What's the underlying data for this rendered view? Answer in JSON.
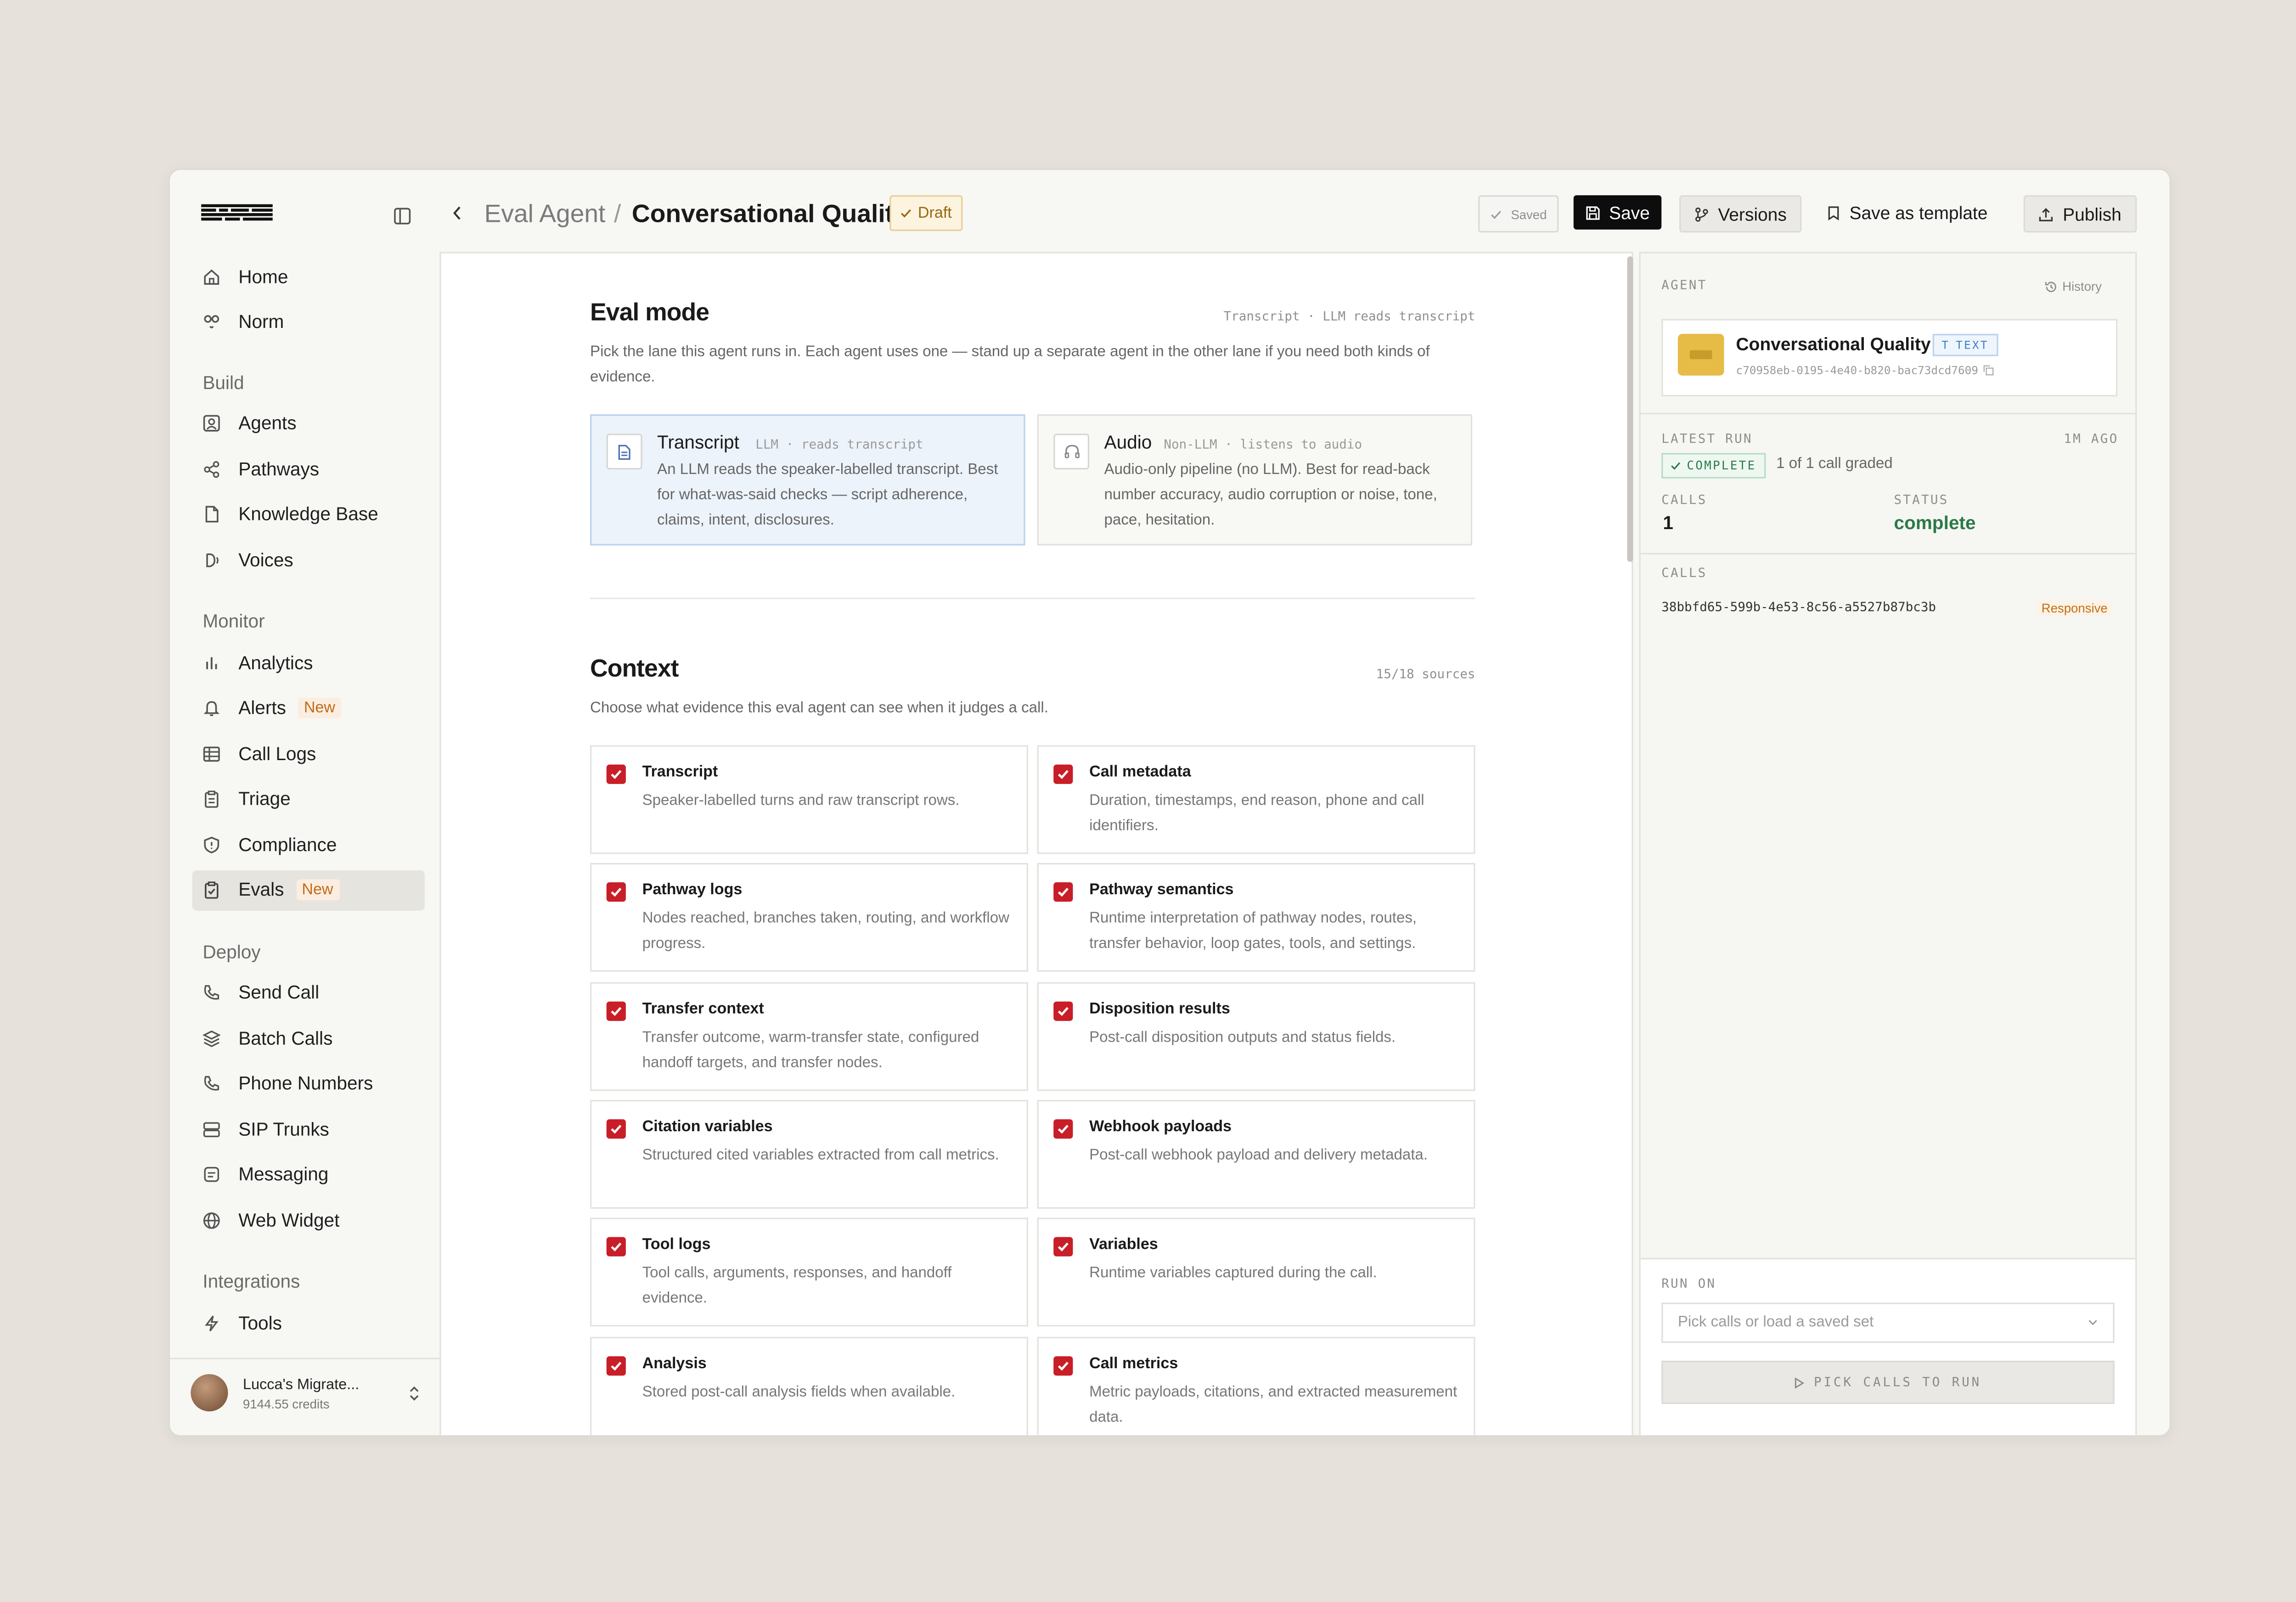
{
  "app": {
    "logo": "logo-icon",
    "colors": {
      "accent_red": "#c81e28",
      "draft_bg": "#fcf4df",
      "selected_blue": "#edf3fb",
      "success_green": "#2b7a47"
    }
  },
  "sidebar": {
    "items_top": [
      {
        "label": "Home",
        "icon": "home-icon"
      },
      {
        "label": "Norm",
        "icon": "norm-icon"
      }
    ],
    "sections": [
      {
        "title": "Build",
        "items": [
          {
            "label": "Agents",
            "icon": "agent-icon"
          },
          {
            "label": "Pathways",
            "icon": "share-nodes-icon"
          },
          {
            "label": "Knowledge Base",
            "icon": "document-icon"
          },
          {
            "label": "Voices",
            "icon": "voice-icon"
          }
        ]
      },
      {
        "title": "Monitor",
        "items": [
          {
            "label": "Analytics",
            "icon": "bar-chart-icon"
          },
          {
            "label": "Alerts",
            "icon": "bell-icon",
            "badge": "New"
          },
          {
            "label": "Call Logs",
            "icon": "table-icon"
          },
          {
            "label": "Triage",
            "icon": "clipboard-icon"
          },
          {
            "label": "Compliance",
            "icon": "shield-icon"
          },
          {
            "label": "Evals",
            "icon": "clipboard-check-icon",
            "badge": "New",
            "active": true
          }
        ]
      },
      {
        "title": "Deploy",
        "items": [
          {
            "label": "Send Call",
            "icon": "phone-icon"
          },
          {
            "label": "Batch Calls",
            "icon": "layers-icon"
          },
          {
            "label": "Phone Numbers",
            "icon": "phone-icon"
          },
          {
            "label": "SIP Trunks",
            "icon": "server-icon"
          },
          {
            "label": "Messaging",
            "icon": "message-icon"
          },
          {
            "label": "Web Widget",
            "icon": "globe-icon"
          }
        ]
      },
      {
        "title": "Integrations",
        "items": [
          {
            "label": "Tools",
            "icon": "bolt-icon"
          }
        ]
      }
    ],
    "user": {
      "name": "Lucca's Migrate...",
      "credits": "9144.55 credits"
    }
  },
  "header": {
    "breadcrumb_parent": "Eval Agent",
    "breadcrumb_sep": "/",
    "title": "Conversational Quality",
    "status": "Draft",
    "saved_label": "Saved",
    "save_label": "Save",
    "versions_label": "Versions",
    "template_label": "Save as template",
    "publish_label": "Publish"
  },
  "eval_mode": {
    "title": "Eval mode",
    "meta": "Transcript · LLM reads transcript",
    "description": "Pick the lane this agent runs in. Each agent uses one — stand up a separate agent in the other lane if you need both kinds of evidence.",
    "modes": [
      {
        "name": "Transcript",
        "tag": "LLM · reads transcript",
        "description": "An LLM reads the speaker-labelled transcript. Best for what-was-said checks — script adherence, claims, intent, disclosures.",
        "selected": true
      },
      {
        "name": "Audio",
        "tag": "Non-LLM · listens to audio",
        "description": "Audio-only pipeline (no LLM). Best for read-back number accuracy, audio corruption or noise, tone, pace, hesitation.",
        "selected": false
      }
    ]
  },
  "context": {
    "title": "Context",
    "meta": "15/18 sources",
    "description": "Choose what evidence this eval agent can see when it judges a call.",
    "options": [
      {
        "title": "Transcript",
        "description": "Speaker-labelled turns and raw transcript rows.",
        "checked": true
      },
      {
        "title": "Call metadata",
        "description": "Duration, timestamps, end reason, phone and call identifiers.",
        "checked": true
      },
      {
        "title": "Pathway logs",
        "description": "Nodes reached, branches taken, routing, and workflow progress.",
        "checked": true
      },
      {
        "title": "Pathway semantics",
        "description": "Runtime interpretation of pathway nodes, routes, transfer behavior, loop gates, tools, and settings.",
        "checked": true
      },
      {
        "title": "Transfer context",
        "description": "Transfer outcome, warm-transfer state, configured handoff targets, and transfer nodes.",
        "checked": true
      },
      {
        "title": "Disposition results",
        "description": "Post-call disposition outputs and status fields.",
        "checked": true
      },
      {
        "title": "Citation variables",
        "description": "Structured cited variables extracted from call metrics.",
        "checked": true
      },
      {
        "title": "Webhook payloads",
        "description": "Post-call webhook payload and delivery metadata.",
        "checked": true
      },
      {
        "title": "Tool logs",
        "description": "Tool calls, arguments, responses, and handoff evidence.",
        "checked": true
      },
      {
        "title": "Variables",
        "description": "Runtime variables captured during the call.",
        "checked": true
      },
      {
        "title": "Analysis",
        "description": "Stored post-call analysis fields when available.",
        "checked": true
      },
      {
        "title": "Call metrics",
        "description": "Metric payloads, citations, and extracted measurement data.",
        "checked": true
      }
    ]
  },
  "panel": {
    "agent_label": "AGENT",
    "history_label": "History",
    "agent_name": "Conversational Quality",
    "agent_type": "TEXT",
    "agent_id": "c70958eb-0195-4e40-b820-bac73dcd7609",
    "latest_run_label": "LATEST RUN",
    "latest_run_time": "1M AGO",
    "run_status_badge": "COMPLETE",
    "graded_text": "1 of 1 call graded",
    "calls_label": "CALLS",
    "calls_value": "1",
    "status_label": "STATUS",
    "status_value": "complete",
    "calls_list_label": "CALLS",
    "calls": [
      {
        "id": "38bbfd65-599b-4e53-8c56-a5527b87bc3b",
        "tag": "Responsive"
      }
    ],
    "run_on_label": "RUN ON",
    "run_on_placeholder": "Pick calls or load a saved set",
    "run_button": "PICK CALLS TO RUN"
  }
}
